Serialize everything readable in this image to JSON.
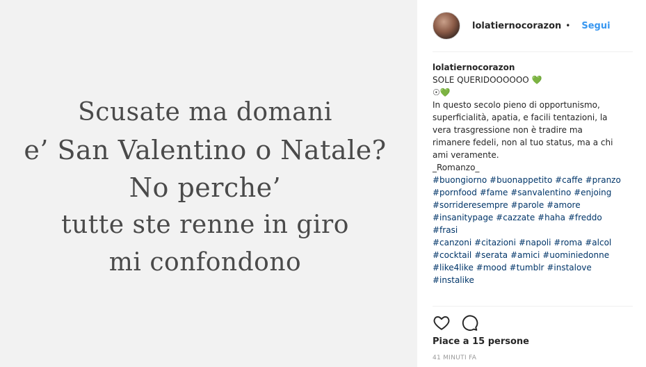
{
  "post": {
    "quote_lines": [
      "Scusate ma domani",
      "e’ San Valentino o Natale?",
      "No perche’",
      "tutte ste renne in giro",
      "mi confondono"
    ]
  },
  "header": {
    "username": "lolatiernocorazon",
    "separator": "•",
    "follow_label": "Segui"
  },
  "caption": {
    "username": "lolatiernocorazon",
    "title": "SOLE QUERIDOOOOOO 💚",
    "emoji_line": "☉💚",
    "body": "In questo secolo pieno di opportunismo, superficialità, apatia, e facili tentazioni, la vera trasgressione non è tradire ma rimanere fedeli, non al tuo status, ma a chi ami veramente.",
    "signature": "_Romanzo_",
    "hashtags": [
      "#buongiorno",
      "#buonappetito",
      "#caffe",
      "#pranzo",
      "#pornfood",
      "#fame",
      "#sanvalentino",
      "#enjoing",
      "#sorrideresempre",
      "#parole",
      "#amore",
      "#insanitypage",
      "#cazzate",
      "#haha",
      "#freddo",
      "#frasi",
      "#canzoni",
      "#citazioni",
      "#napoli",
      "#roma",
      "#alcol",
      "#cocktail",
      "#serata",
      "#amici",
      "#uominiedonne",
      "#like4like",
      "#mood",
      "#tumblr",
      "#instalove",
      "#instalike"
    ]
  },
  "actions": {
    "like_icon": "heart-icon",
    "comment_icon": "comment-icon"
  },
  "likes_text": "Piace a 15 persone",
  "timestamp": "41 MINUTI FA"
}
